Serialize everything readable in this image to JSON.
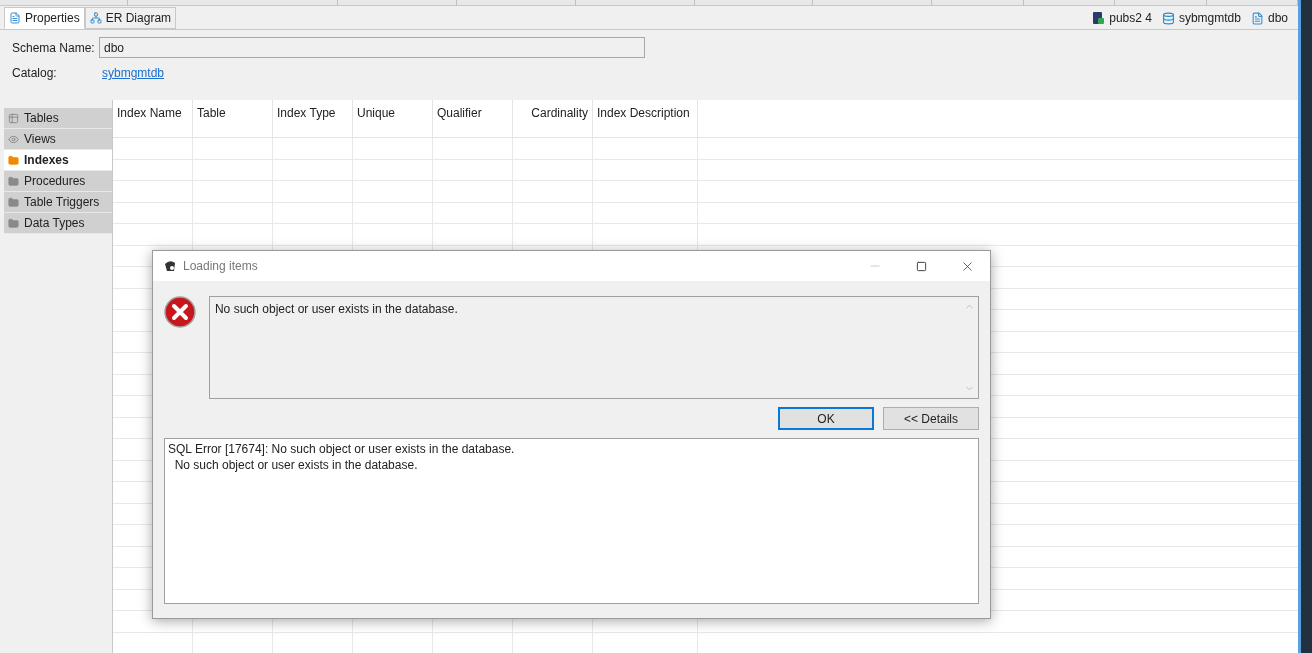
{
  "editor_tabs": [
    {
      "label": "Properties",
      "selected": true
    },
    {
      "label": "ER Diagram",
      "selected": false
    }
  ],
  "breadcrumbs": [
    {
      "kind": "server",
      "label": "pubs2 4"
    },
    {
      "kind": "database",
      "label": "sybmgmtdb"
    },
    {
      "kind": "schema",
      "label": "dbo"
    }
  ],
  "form": {
    "schema_name_label": "Schema Name:",
    "schema_name": "dbo",
    "catalog_label": "Catalog:",
    "catalog": "sybmgmtdb"
  },
  "sidebar": {
    "items": [
      {
        "label": "Tables",
        "kind": "table",
        "selected": false
      },
      {
        "label": "Views",
        "kind": "view",
        "selected": false
      },
      {
        "label": "Indexes",
        "kind": "folder",
        "selected": true
      },
      {
        "label": "Procedures",
        "kind": "folder",
        "selected": false
      },
      {
        "label": "Table Triggers",
        "kind": "folder",
        "selected": false
      },
      {
        "label": "Data Types",
        "kind": "folder",
        "selected": false
      }
    ]
  },
  "table": {
    "columns": [
      {
        "label": "Index Name",
        "kind": "text"
      },
      {
        "label": "Table",
        "kind": "text"
      },
      {
        "label": "Index Type",
        "kind": "text"
      },
      {
        "label": "Unique",
        "kind": "text"
      },
      {
        "label": "Qualifier",
        "kind": "text"
      },
      {
        "label": "Cardinality",
        "kind": "number"
      },
      {
        "label": "Index Description",
        "kind": "text"
      }
    ]
  },
  "dialog": {
    "title": "Loading items",
    "message": "No such object or user exists in the database.",
    "buttons": [
      {
        "label": "OK",
        "default": true
      },
      {
        "label": "<< Details",
        "default": false
      }
    ],
    "details": [
      "SQL Error [17674]: No such object or user exists in the database.",
      "  No such object or user exists in the database."
    ]
  }
}
